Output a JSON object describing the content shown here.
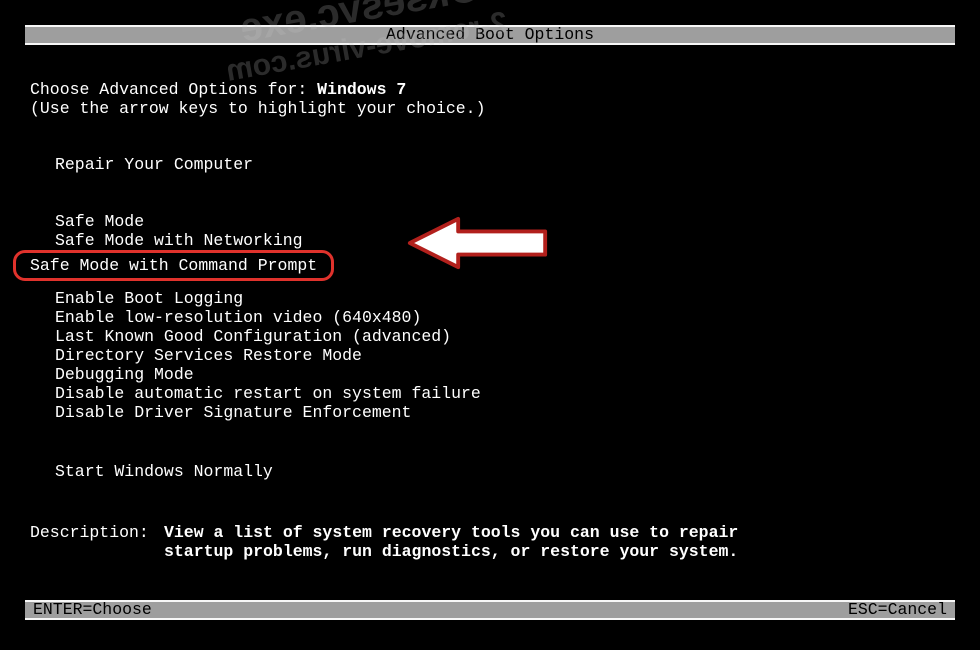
{
  "title": "Advanced Boot Options",
  "intro": {
    "line1a": "Choose Advanced Options for: ",
    "line1b": "Windows 7",
    "line2": "(Use the arrow keys to highlight your choice.)"
  },
  "group1": {
    "repair": "Repair Your Computer"
  },
  "group2": {
    "safe": "Safe Mode",
    "safenet": "Safe Mode with Networking",
    "safecmd": "Safe Mode with Command Prompt"
  },
  "group3": {
    "bootlog": "Enable Boot Logging",
    "lowres": "Enable low-resolution video (640x480)",
    "lkgc": "Last Known Good Configuration (advanced)",
    "dsrm": "Directory Services Restore Mode",
    "debug": "Debugging Mode",
    "noauto": "Disable automatic restart on system failure",
    "nodse": "Disable Driver Signature Enforcement"
  },
  "group4": {
    "normal": "Start Windows Normally"
  },
  "desc": {
    "label": "Description:",
    "text1": "View a list of system recovery tools you can use to repair",
    "text2": "startup problems, run diagnostics, or restore your system."
  },
  "footer": {
    "left": "ENTER=Choose",
    "right": "ESC=Cancel"
  },
  "watermark": {
    "l1": "Oksesvc.exe",
    "l2": "2-remove-virus.com"
  }
}
